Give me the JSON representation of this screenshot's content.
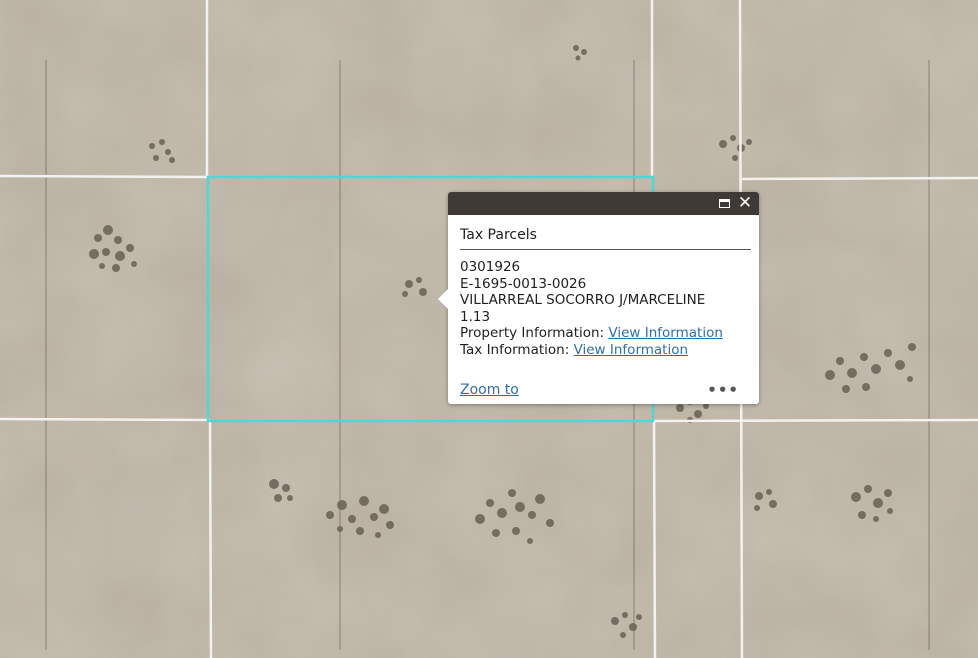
{
  "map": {
    "highlight_color": "#4dd8d6",
    "parcel_line_color": "#ffffff",
    "ground_color": "#b9b09f"
  },
  "popup": {
    "title": "Tax Parcels",
    "parcel_id": "0301926",
    "map_number": "E-1695-0013-0026",
    "owner": "VILLARREAL SOCORRO J/MARCELINE",
    "acreage": "1.13",
    "property_info_label": "Property Information:",
    "property_info_link": "View Information",
    "tax_info_label": "Tax Information:",
    "tax_info_link": "View Information",
    "zoom_to": "Zoom to",
    "icons": {
      "maximize": "maximize-icon",
      "close": "close-icon",
      "more": "more-options-icon"
    }
  }
}
